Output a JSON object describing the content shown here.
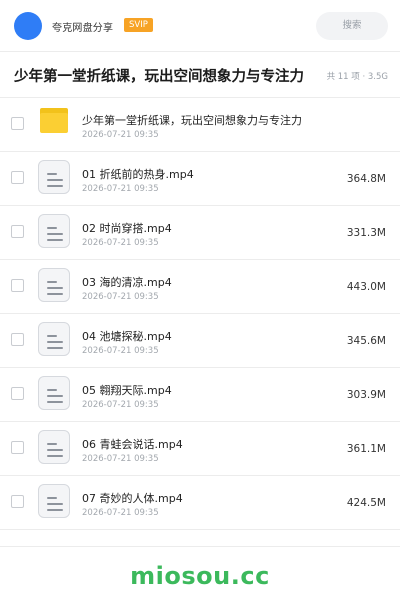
{
  "header": {
    "app_name": "夸克网盘分享",
    "badge": "SVIP",
    "search_placeholder": "搜索",
    "accent_color": "#2f7df6"
  },
  "share": {
    "title": "少年第一堂折纸课，玩出空间想象力与专注力",
    "meta": "共 11 项 · 3.5G"
  },
  "items": [
    {
      "type": "folder",
      "name": "少年第一堂折纸课，玩出空间想象力与专注力",
      "date": "2026-07-21 09:35",
      "size": ""
    },
    {
      "type": "video",
      "name": "01 折纸前的热身.mp4",
      "date": "2026-07-21 09:35",
      "size": "364.8M"
    },
    {
      "type": "video",
      "name": "02 时尚穿搭.mp4",
      "date": "2026-07-21 09:35",
      "size": "331.3M"
    },
    {
      "type": "video",
      "name": "03 海的清凉.mp4",
      "date": "2026-07-21 09:35",
      "size": "443.0M"
    },
    {
      "type": "video",
      "name": "04 池塘探秘.mp4",
      "date": "2026-07-21 09:35",
      "size": "345.6M"
    },
    {
      "type": "video",
      "name": "05 翱翔天际.mp4",
      "date": "2026-07-21 09:35",
      "size": "303.9M"
    },
    {
      "type": "video",
      "name": "06 青蛙会说话.mp4",
      "date": "2026-07-21 09:35",
      "size": "361.1M"
    },
    {
      "type": "video",
      "name": "07 奇妙的人体.mp4",
      "date": "2026-07-21 09:35",
      "size": "424.5M"
    }
  ],
  "footer": {
    "watermark": "miosou.cc",
    "watermark_color": "#3cb95c"
  }
}
